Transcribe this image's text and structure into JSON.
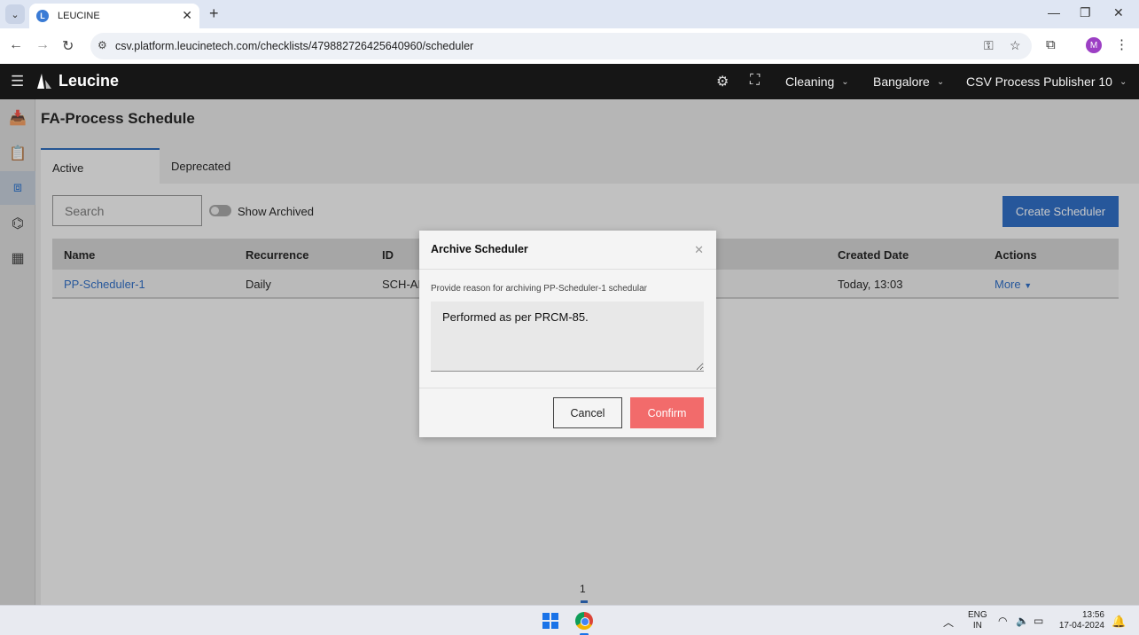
{
  "browser": {
    "tab_title": "LEUCINE",
    "url": "csv.platform.leucinetech.com/checklists/479882726425640960/scheduler",
    "profile_initial": "M"
  },
  "header": {
    "brand": "Leucine",
    "menus": [
      "Cleaning",
      "Bangalore",
      "CSV Process Publisher 10"
    ]
  },
  "page": {
    "title": "FA-Process Schedule",
    "tabs": [
      "Active",
      "Deprecated"
    ],
    "search_placeholder": "Search",
    "show_archived_label": "Show Archived",
    "create_button": "Create Scheduler"
  },
  "table": {
    "columns": [
      "Name",
      "Recurrence",
      "ID",
      "Created Date",
      "Actions"
    ],
    "rows": [
      {
        "name": "PP-Scheduler-1",
        "recurrence": "Daily",
        "id": "SCH-AF",
        "created": "Today, 13:03",
        "action": "More"
      }
    ]
  },
  "pagination": {
    "current": "1"
  },
  "modal": {
    "title": "Archive Scheduler",
    "prompt": "Provide reason for archiving PP-Scheduler-1 schedular",
    "reason": "Performed as per PRCM-85.",
    "cancel": "Cancel",
    "confirm": "Confirm"
  },
  "taskbar": {
    "lang_line1": "ENG",
    "lang_line2": "IN",
    "time": "13:56",
    "date": "17-04-2024"
  },
  "colors": {
    "primary": "#1e62c0",
    "danger": "#f26b6b",
    "header_bg": "#161616"
  }
}
